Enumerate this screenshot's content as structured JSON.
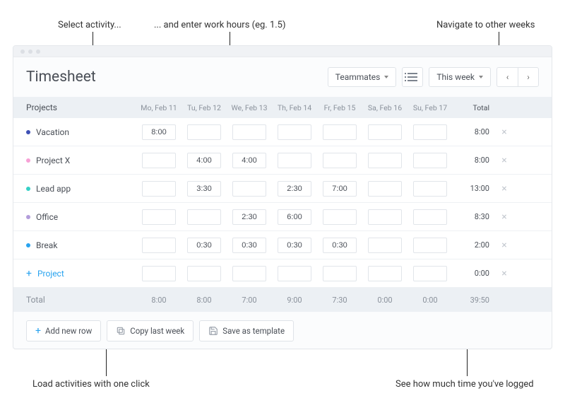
{
  "annotations": {
    "select_activity": "Select activity...",
    "enter_hours": "... and enter work hours (eg. 1.5)",
    "navigate_weeks": "Navigate to other weeks",
    "load_activities": "Load activities with one click",
    "see_time": "See how much time you've logged"
  },
  "header": {
    "title": "Timesheet",
    "teammates": "Teammates",
    "this_week": "This week"
  },
  "columns": {
    "projects": "Projects",
    "d0": "Mo, Feb 11",
    "d1": "Tu, Feb 12",
    "d2": "We, Feb 13",
    "d3": "Th, Feb 14",
    "d4": "Fr, Feb 15",
    "d5": "Sa, Feb 16",
    "d6": "Su, Feb 17",
    "total": "Total"
  },
  "rows": [
    {
      "color": "#3f51b5",
      "name": "Vacation",
      "cells": [
        "8:00",
        "",
        "",
        "",
        "",
        "",
        ""
      ],
      "total": "8:00"
    },
    {
      "color": "#f7a1d6",
      "name": "Project X",
      "cells": [
        "",
        "4:00",
        "4:00",
        "",
        "",
        "",
        ""
      ],
      "total": "8:00"
    },
    {
      "color": "#35d0c6",
      "name": "Lead app",
      "cells": [
        "",
        "3:30",
        "",
        "2:30",
        "7:00",
        "",
        ""
      ],
      "total": "13:00"
    },
    {
      "color": "#b39ddb",
      "name": "Office",
      "cells": [
        "",
        "",
        "2:30",
        "6:00",
        "",
        "",
        ""
      ],
      "total": "8:30"
    },
    {
      "color": "#29a3ef",
      "name": "Break",
      "cells": [
        "",
        "0:30",
        "0:30",
        "0:30",
        "0:30",
        "",
        ""
      ],
      "total": "2:00"
    }
  ],
  "add_row": {
    "label": "Project",
    "cells": [
      "",
      "",
      "",
      "",
      "",
      "",
      ""
    ],
    "total": "0:00"
  },
  "footer": {
    "label": "Total",
    "cells": [
      "8:00",
      "8:00",
      "7:00",
      "9:00",
      "7:30",
      "0:00",
      "0:00"
    ],
    "total": "39:50"
  },
  "actions": {
    "add_new_row": "Add new row",
    "copy_last_week": "Copy last week",
    "save_template": "Save as template"
  }
}
